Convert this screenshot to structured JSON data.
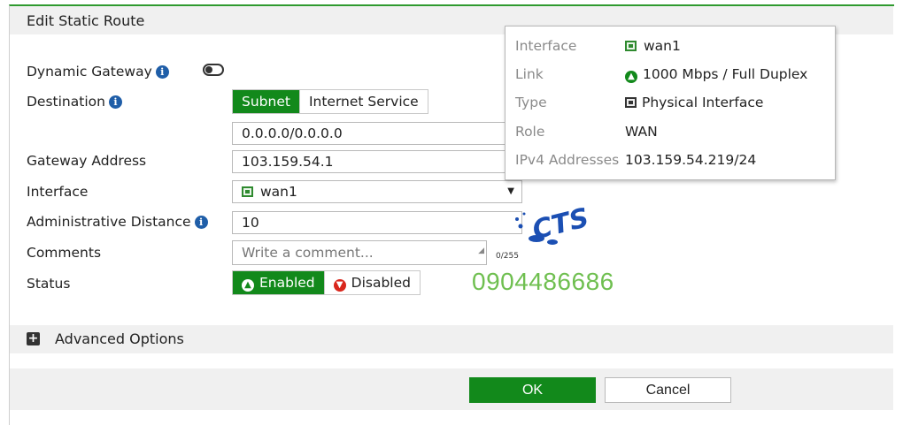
{
  "dialog": {
    "title": "Edit Static Route"
  },
  "form": {
    "dynamic_gateway_label": "Dynamic Gateway",
    "dynamic_gateway_enabled": false,
    "destination_label": "Destination",
    "destination_options": [
      "Subnet",
      "Internet Service"
    ],
    "destination_selected": "Subnet",
    "destination_value": "0.0.0.0/0.0.0.0",
    "gateway_label": "Gateway Address",
    "gateway_value": "103.159.54.1",
    "interface_label": "Interface",
    "interface_value": "wan1",
    "distance_label": "Administrative Distance",
    "distance_value": "10",
    "comments_label": "Comments",
    "comments_placeholder": "Write a comment...",
    "comments_counter": "0/255",
    "status_label": "Status",
    "status_options": [
      "Enabled",
      "Disabled"
    ],
    "status_selected": "Enabled"
  },
  "tooltip": {
    "rows": [
      {
        "key": "Interface",
        "value": "wan1",
        "icon": "network-port-icon"
      },
      {
        "key": "Link",
        "value": "1000 Mbps / Full Duplex",
        "icon": "link-up-icon"
      },
      {
        "key": "Type",
        "value": "Physical Interface",
        "icon": "physical-interface-icon"
      },
      {
        "key": "Role",
        "value": "WAN"
      },
      {
        "key": "IPv4 Addresses",
        "value": "103.159.54.219/24"
      }
    ]
  },
  "watermark": {
    "logo_text": "CTS",
    "phone": "0904486686"
  },
  "advanced": {
    "label": "Advanced Options"
  },
  "footer": {
    "ok_label": "OK",
    "cancel_label": "Cancel"
  },
  "colors": {
    "accent_green": "#12891b",
    "info_blue": "#1f5ea8",
    "watermark_green": "#6fbf50",
    "logo_blue": "#1b4fb3"
  }
}
